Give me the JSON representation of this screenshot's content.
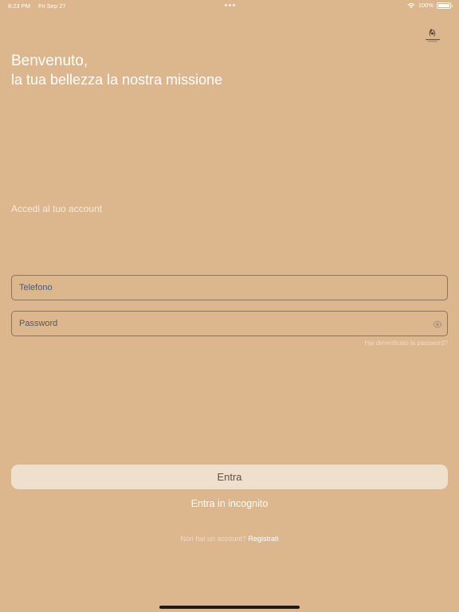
{
  "status_bar": {
    "time": "8:23 PM",
    "date": "Fri Sep 27",
    "battery_percent": "100%",
    "battery_level": 1.0
  },
  "logo": {
    "icon": "brand-logo-icon"
  },
  "welcome": {
    "title": "Benvenuto,",
    "subtitle": "la tua bellezza la nostra missione"
  },
  "login": {
    "caption": "Accedi al tuo account",
    "phone_placeholder": "Telefono",
    "password_placeholder": "Password",
    "password_icon": "eye-icon",
    "forgot_password": "Hai dimenticato la password?"
  },
  "actions": {
    "enter_label": "Entra",
    "incognito_label": "Entra in incognito",
    "no_account": "Non hai un account?",
    "register_label": "Registrati"
  },
  "colors": {
    "background": "#dcb68c",
    "button_bg": "#efdfcd",
    "field_border": "#8a7560",
    "field_text": "#4e5a75"
  }
}
